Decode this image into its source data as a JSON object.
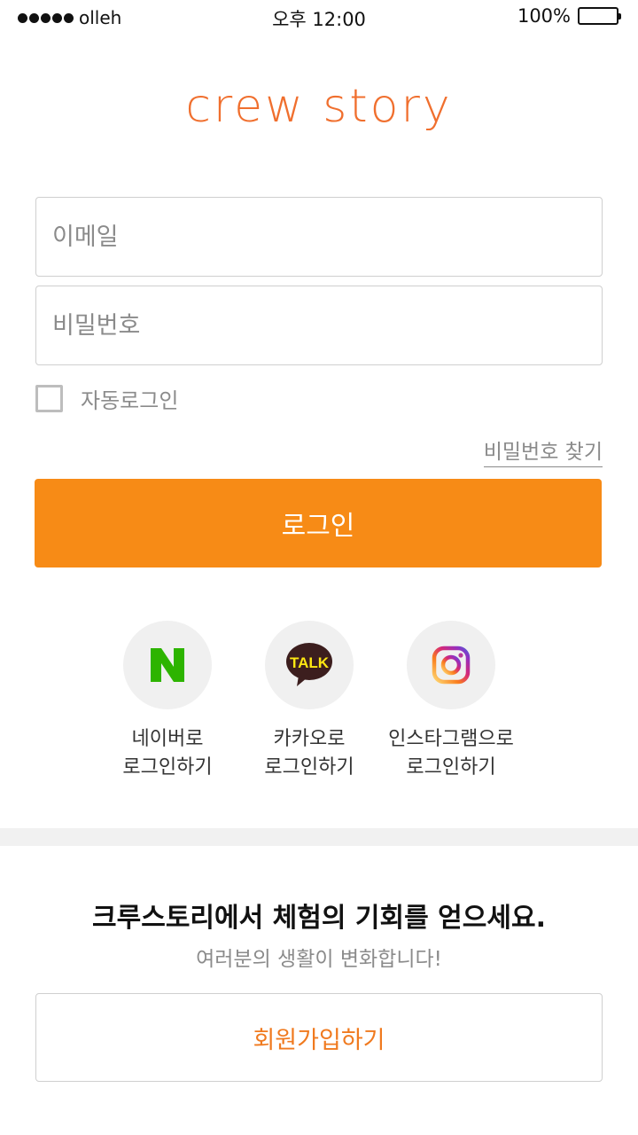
{
  "status_bar": {
    "carrier": "olleh",
    "time": "오후 12:00",
    "battery": "100%"
  },
  "logo": {
    "text": "crew story"
  },
  "form": {
    "email_placeholder": "이메일",
    "password_placeholder": "비밀번호",
    "auto_login_label": "자동로그인",
    "find_password_label": "비밀번호 찾기",
    "login_button_label": "로그인"
  },
  "social": [
    {
      "icon": "naver-icon",
      "line1": "네이버로",
      "line2": "로그인하기"
    },
    {
      "icon": "kakaotalk-icon",
      "line1": "카카오로",
      "line2": "로그인하기",
      "icon_text": "TALK"
    },
    {
      "icon": "instagram-icon",
      "line1": "인스타그램으로",
      "line2": "로그인하기"
    }
  ],
  "promo": {
    "title": "크루스토리에서 체험의 기회를 얻으세요.",
    "subtitle": "여러분의 생활이 변화합니다!"
  },
  "signup": {
    "button_label": "회원가입하기"
  },
  "colors": {
    "brand": "#f06f2e",
    "login_button": "#f78b16",
    "naver_green": "#2db400",
    "kakao_yellow": "#ffe812"
  }
}
